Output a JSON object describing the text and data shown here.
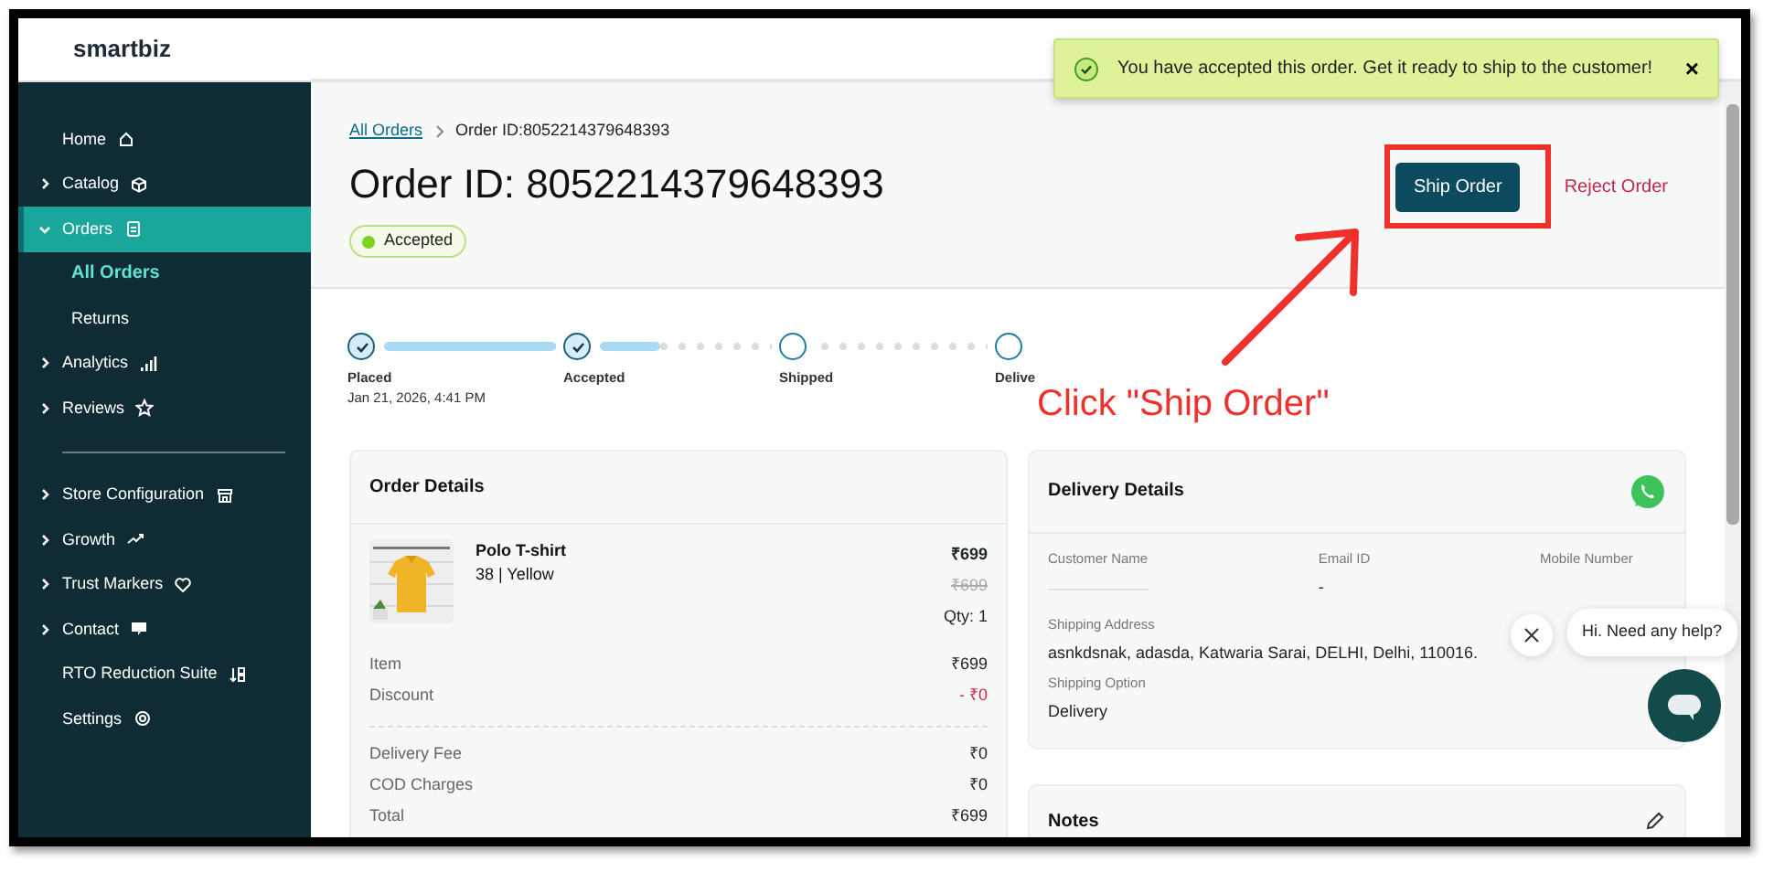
{
  "sidebar": {
    "logo": "smartbiz",
    "sections": [
      [
        {
          "label": "Home",
          "expandable": false,
          "selected": false
        },
        {
          "label": "Catalog",
          "expandable": true,
          "expanded": false,
          "selected": false
        },
        {
          "label": "Orders",
          "expandable": true,
          "expanded": true,
          "selected": true,
          "children": [
            {
              "label": "All Orders",
              "selected": true
            },
            {
              "label": "Returns",
              "selected": false
            }
          ]
        },
        {
          "label": "Analytics",
          "expandable": true,
          "expanded": false,
          "selected": false
        },
        {
          "label": "Reviews",
          "expandable": true,
          "expanded": false,
          "selected": false
        }
      ],
      [
        {
          "label": "Store Configuration",
          "expandable": true,
          "expanded": false,
          "selected": false
        },
        {
          "label": "Growth",
          "expandable": true,
          "expanded": false,
          "selected": false
        },
        {
          "label": "Trust Markers",
          "expandable": true,
          "expanded": false,
          "selected": false
        },
        {
          "label": "Contact",
          "expandable": true,
          "expanded": false,
          "selected": false
        },
        {
          "label": "RTO Reduction Suite",
          "expandable": false,
          "selected": false
        },
        {
          "label": "Settings",
          "expandable": false,
          "selected": false
        }
      ]
    ]
  },
  "toast": {
    "message": "You have accepted this order. Get it ready to ship to the customer!",
    "close": "×"
  },
  "breadcrumb": [
    {
      "label": "All Orders",
      "link": true
    },
    {
      "label": "Order ID:8052214379648393",
      "link": false
    }
  ],
  "title": "Order ID: 8052214379648393",
  "status": {
    "label": "Accepted"
  },
  "actions": {
    "primary": "Ship Order",
    "secondary": "Reject Order"
  },
  "steps": [
    {
      "label": "Placed",
      "date": "Jan 21, 2026, 4:41 PM",
      "done": true,
      "level": 1
    },
    {
      "label": "Accepted",
      "done": true,
      "level": 0.35
    },
    {
      "label": "Shipped",
      "done": false
    },
    {
      "label": "Delive",
      "done": false
    }
  ],
  "order_details": {
    "title": "Order Details",
    "item": {
      "kind": "picture",
      "name": "Polo T-shirt",
      "variant": "38 | Yellow",
      "price": "₹699",
      "mrp": "₹699",
      "qty": "Qty: 1"
    },
    "summary": [
      [
        {
          "label": "Item",
          "value": "₹699",
          "kind": "normal"
        },
        {
          "label": "Discount",
          "value": "- ₹0",
          "kind": "discount"
        }
      ],
      [
        {
          "label": "Delivery Fee",
          "value": "₹0",
          "kind": "normal"
        },
        {
          "label": "COD Charges",
          "value": "₹0",
          "kind": "normal"
        },
        {
          "label": "Total",
          "value": "₹699",
          "kind": "normal"
        }
      ]
    ]
  },
  "delivery_details": {
    "title": "Delivery Details",
    "fields": [
      {
        "label": "Customer Name",
        "redacted": true
      },
      {
        "label": "Email ID",
        "value": "-",
        "redacted": false
      },
      {
        "label": "Mobile Number",
        "redacted": false
      }
    ],
    "shipping_address_label": "Shipping Address",
    "shipping_address": "asnkdsnak, adasda, Katwaria Sarai, DELHI, Delhi, 110016.",
    "shipping_option_label": "Shipping Option",
    "shipping_option": "Delivery"
  },
  "notes": {
    "title": "Notes"
  },
  "chat": {
    "message": "Hi. Need any help?"
  },
  "annotation": {
    "text": "Click \"Ship Order\""
  }
}
